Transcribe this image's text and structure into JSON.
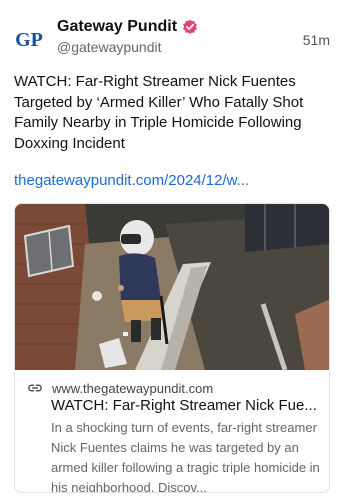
{
  "author": {
    "display_name": "Gateway Pundit",
    "handle": "@gatewaypundit",
    "avatar_text": "GP",
    "verified": true
  },
  "post": {
    "time": "51m",
    "text": "WATCH: Far-Right Streamer Nick Fuentes Targeted by ‘Armed Killer’ Who Fatally Shot Family Nearby in Triple Homicide Following Doxxing Incident",
    "link_text": "thegatewaypundit.com/2024/12/w..."
  },
  "link_card": {
    "domain": "www.thegatewaypundit.com",
    "title": "WATCH: Far-Right Streamer Nick Fue...",
    "description": "In a shocking turn of events, far-right streamer Nick Fuentes claims he was targeted by an armed killer following a tragic triple homicide in his neighborhood. Discov..."
  },
  "colors": {
    "link": "#1a6bd6",
    "avatar_blue": "#1f4f9c",
    "verified_pink": "#e0457b"
  },
  "icons": {
    "verified": "verified-badge-icon",
    "link": "link-icon"
  }
}
